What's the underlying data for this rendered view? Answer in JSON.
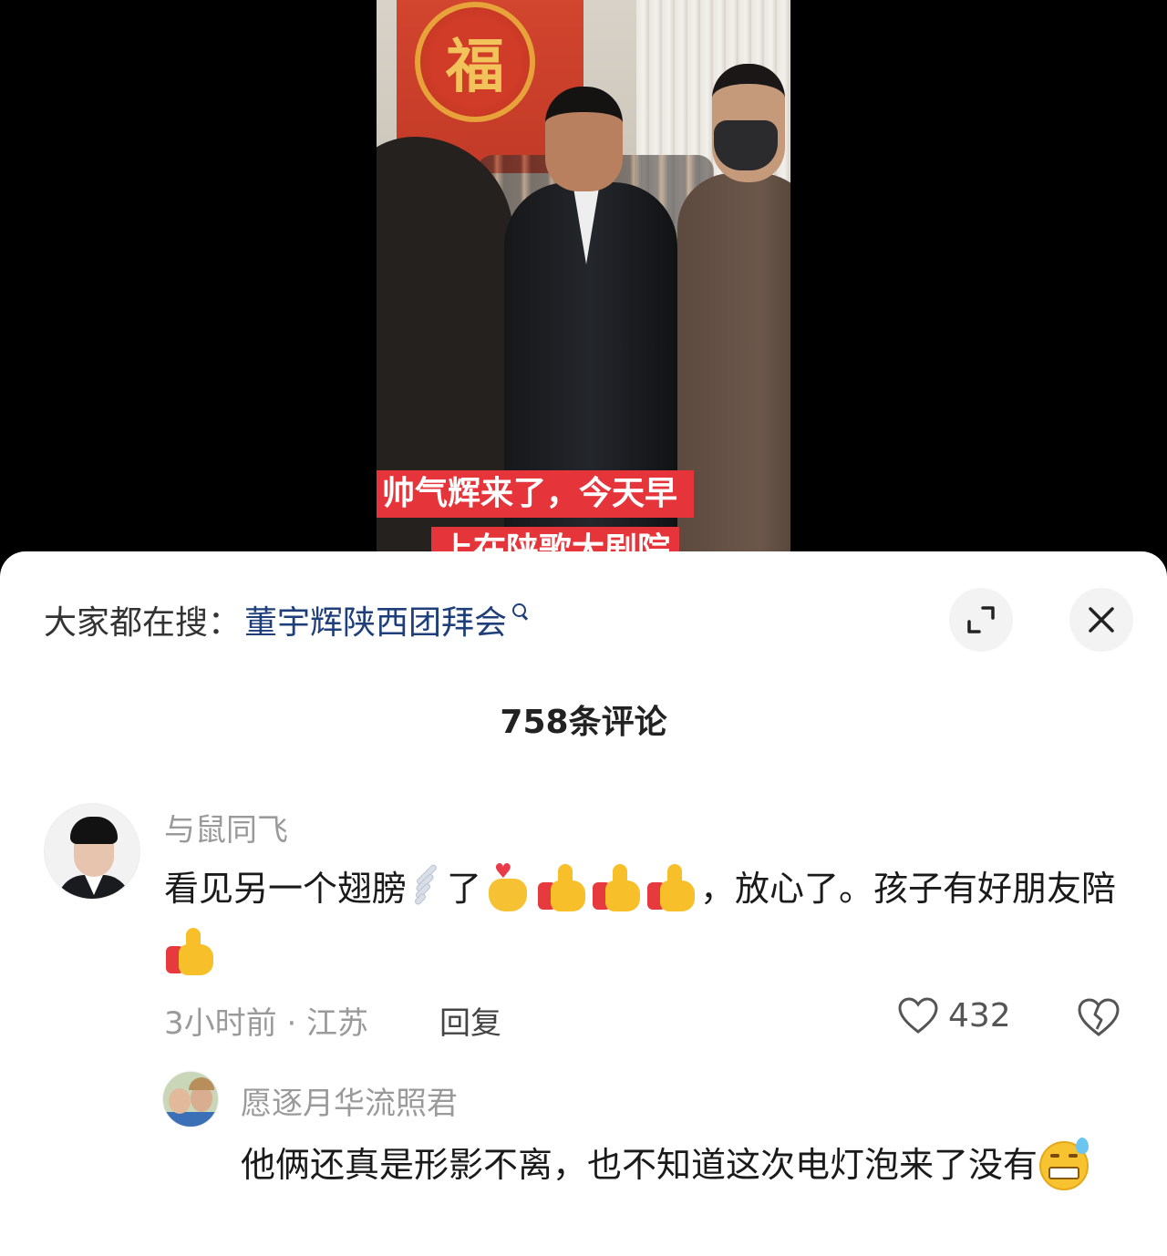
{
  "video": {
    "caption_line1": "帅气辉来了，今天早",
    "caption_line2": "上在陕歌大剧院",
    "banner_glyph": "福"
  },
  "search": {
    "prefix": "大家都在搜：",
    "query": "董宇辉陕西团拜会"
  },
  "header": {
    "comments_count": "758条评论"
  },
  "comments": [
    {
      "username": "与鼠同飞",
      "text_part1": "看见另一个翅膀",
      "text_part2": "了",
      "text_part3": "，放心了。孩子有好朋友陪",
      "emojis": [
        "wing-icon",
        "finger-heart-icon",
        "thumbs-up-icon",
        "thumbs-up-icon",
        "thumbs-up-icon",
        "thumbs-up-icon"
      ],
      "meta": "3小时前 · 江苏",
      "reply_label": "回复",
      "likes": "432"
    }
  ],
  "replies": [
    {
      "username": "愿逐月华流照君",
      "text": "他俩还真是形影不离，也不知道这次电灯泡来了没有",
      "emoji": "grinning-sweat-icon"
    }
  ],
  "colors": {
    "caption_bg": "#e5343a",
    "search_query": "#1f3f7a",
    "muted_text": "#9a9a9a"
  }
}
